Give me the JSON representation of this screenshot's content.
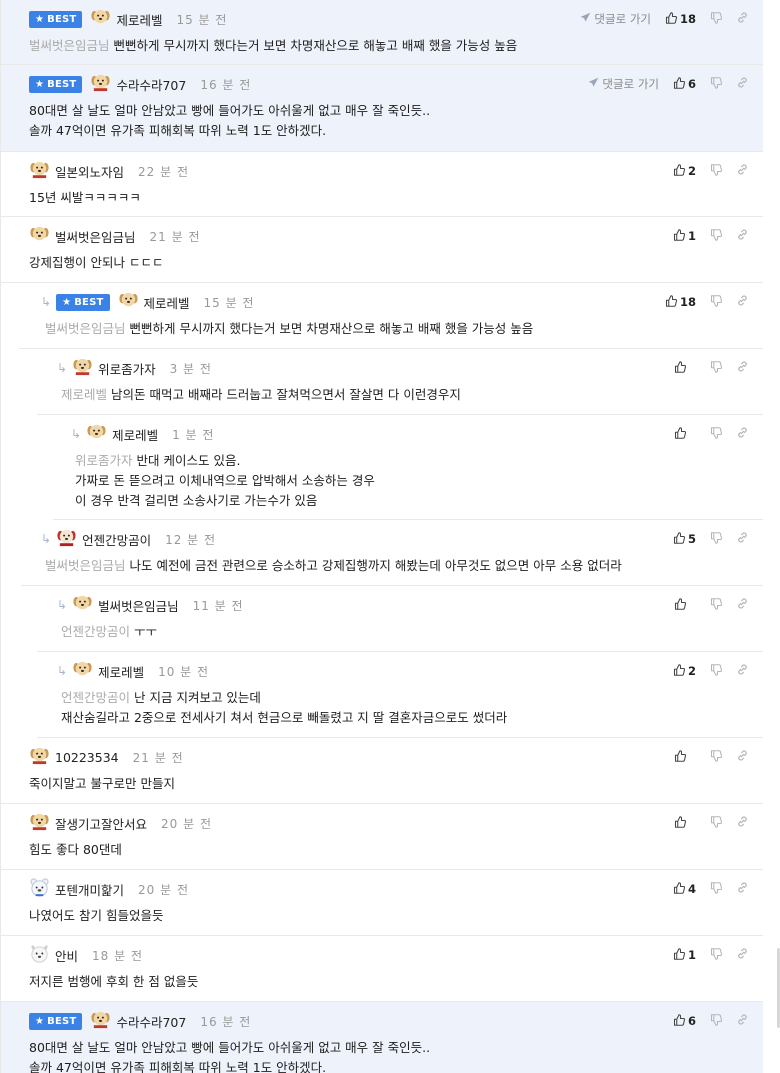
{
  "ui": {
    "best_label": "BEST",
    "goto_label": "댓글로 가기"
  },
  "comments": [
    {
      "nick": "제로레벨",
      "time": "15 분 전",
      "best": true,
      "avatar": "puppy",
      "mention": "벌써벗은임금님",
      "lines": [
        "뻔뻔하게 무시까지 했다는거 보면 차명재산으로 해놓고 배째 했을 가능성 높음"
      ],
      "likes": "18",
      "goto": true
    },
    {
      "nick": "수라수라707",
      "time": "16 분 전",
      "best": true,
      "avatar": "puppy-scarf",
      "mention": "",
      "lines": [
        "80대면 살 날도 얼마 안남았고 빵에 들어가도 아쉬울게 없고 매우 잘 죽인듯..",
        "솔까 47억이면 유가족 피해회복 따위 노력 1도 안하겠다."
      ],
      "likes": "6",
      "goto": true
    },
    {
      "nick": "일본외노자임",
      "time": "22 분 전",
      "best": false,
      "avatar": "puppy-scarf",
      "mention": "",
      "lines": [
        "15년 씨발ㅋㅋㅋㅋㅋ"
      ],
      "likes": "2",
      "goto": false
    },
    {
      "nick": "벌써벗은임금님",
      "time": "21 분 전",
      "best": false,
      "avatar": "puppy",
      "mention": "",
      "lines": [
        "강제집행이 안되나 ㄷㄷㄷ"
      ],
      "likes": "1",
      "goto": false
    },
    {
      "nick": "제로레벨",
      "time": "15 분 전",
      "best": true,
      "avatar": "puppy",
      "mention": "벌써벗은임금님",
      "lines": [
        "뻔뻔하게 무시까지 했다는거 보면 차명재산으로 해놓고 배째 했을 가능성 높음"
      ],
      "likes": "18",
      "goto": false
    },
    {
      "nick": "위로좀가자",
      "time": "3 분 전",
      "best": false,
      "avatar": "puppy-scarf",
      "mention": "제로레벨",
      "lines": [
        "남의돈 때먹고 배째라 드러눕고 잘쳐먹으면서 잘살면 다 이런경우지"
      ],
      "likes": "",
      "goto": false
    },
    {
      "nick": "제로레벨",
      "time": "1 분 전",
      "best": false,
      "avatar": "puppy",
      "mention": "위로좀가자",
      "lines": [
        "반대 케이스도 있음.",
        "가짜로 돈 뜯으려고 이체내역으로 압박해서 소송하는 경우",
        "이 경우 반격 걸리면 소송사기로 가는수가 있음"
      ],
      "likes": "",
      "goto": false
    },
    {
      "nick": "언젠간망곰이",
      "time": "12 분 전",
      "best": false,
      "avatar": "puppy-red",
      "mention": "벌써벗은임금님",
      "lines": [
        "나도 예전에 금전 관련으로 승소하고 강제집행까지 해봤는데 아무것도 없으면 아무 소용 없더라"
      ],
      "likes": "5",
      "goto": false
    },
    {
      "nick": "벌써벗은임금님",
      "time": "11 분 전",
      "best": false,
      "avatar": "puppy",
      "mention": "언젠간망곰이",
      "lines": [
        "ㅜㅜ"
      ],
      "likes": "",
      "goto": false
    },
    {
      "nick": "제로레벨",
      "time": "10 분 전",
      "best": false,
      "avatar": "puppy",
      "mention": "언젠간망곰이",
      "lines": [
        "난 지금 지켜보고 있는데",
        "재산숨길라고 2중으로 전세사기 쳐서 현금으로 빼돌렸고 지 딸 결혼자금으로도 썼더라"
      ],
      "likes": "2",
      "goto": false
    },
    {
      "nick": "10223534",
      "time": "21 분 전",
      "best": false,
      "avatar": "puppy-scarf",
      "mention": "",
      "lines": [
        "죽이지말고 불구로만 만들지"
      ],
      "likes": "",
      "goto": false
    },
    {
      "nick": "잘생기고잘안서요",
      "time": "20 분 전",
      "best": false,
      "avatar": "puppy-scarf",
      "mention": "",
      "lines": [
        "힘도 좋다 80댄데"
      ],
      "likes": "",
      "goto": false
    },
    {
      "nick": "포텐개미핥기",
      "time": "20 분 전",
      "best": false,
      "avatar": "bear",
      "mention": "",
      "lines": [
        "나였어도 참기 힘들었을듯"
      ],
      "likes": "4",
      "goto": false
    },
    {
      "nick": "안비",
      "time": "18 분 전",
      "best": false,
      "avatar": "white-dog",
      "mention": "",
      "lines": [
        "저지른 범행에 후회 한 점 없을듯"
      ],
      "likes": "1",
      "goto": false
    },
    {
      "nick": "수라수라707",
      "time": "16 분 전",
      "best": true,
      "avatar": "puppy-scarf",
      "mention": "",
      "lines": [
        "80대면 살 날도 얼마 안남았고 빵에 들어가도 아쉬울게 없고 매우 잘 죽인듯..",
        "솔까 47억이면 유가족 피해회복 따위 노력 1도 안하겠다."
      ],
      "likes": "6",
      "goto": false
    }
  ]
}
